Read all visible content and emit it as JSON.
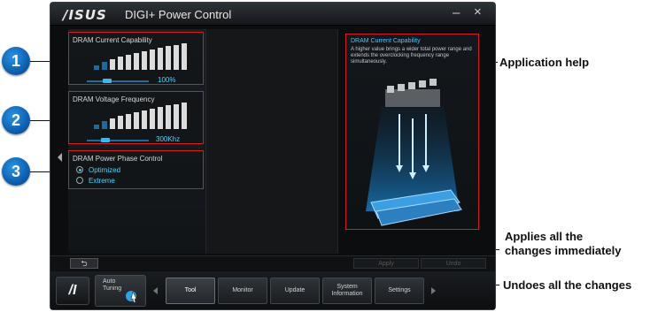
{
  "window": {
    "logo": "/ISUS",
    "title": "DIGI+ Power Control",
    "minimize": "–",
    "close": "×"
  },
  "panels": {
    "current": {
      "title": "DRAM Current Capability",
      "value": "100%"
    },
    "voltage": {
      "title": "DRAM Voltage Frequency",
      "value": "300Khz"
    },
    "phase": {
      "title": "DRAM Power Phase Control",
      "options": [
        "Optimized",
        "Extreme"
      ],
      "selected": "Optimized"
    }
  },
  "help": {
    "title": "DRAM Current Capability",
    "text": "A higher value brings a wider total power range and extends the overclocking frequency range simultaneously."
  },
  "actions": {
    "back": "⮌",
    "apply": "Apply",
    "undo": "Undo"
  },
  "toolbar": {
    "logo": "/I",
    "auto_tuning": "Auto Tuning",
    "tabs": [
      "Tool",
      "Monitor",
      "Update",
      "System Information",
      "Settings"
    ],
    "active_tab": "Tool"
  },
  "annotations": {
    "badges": [
      "1",
      "2",
      "3"
    ],
    "app_help": "Application help",
    "apply_note_line1": "Applies all the",
    "apply_note_line2": "changes immediately",
    "undo_note": "Undoes all the changes"
  },
  "colors": {
    "highlight": "#d21e1e",
    "accent": "#47c8ff",
    "badge": "#0e5fb0"
  }
}
